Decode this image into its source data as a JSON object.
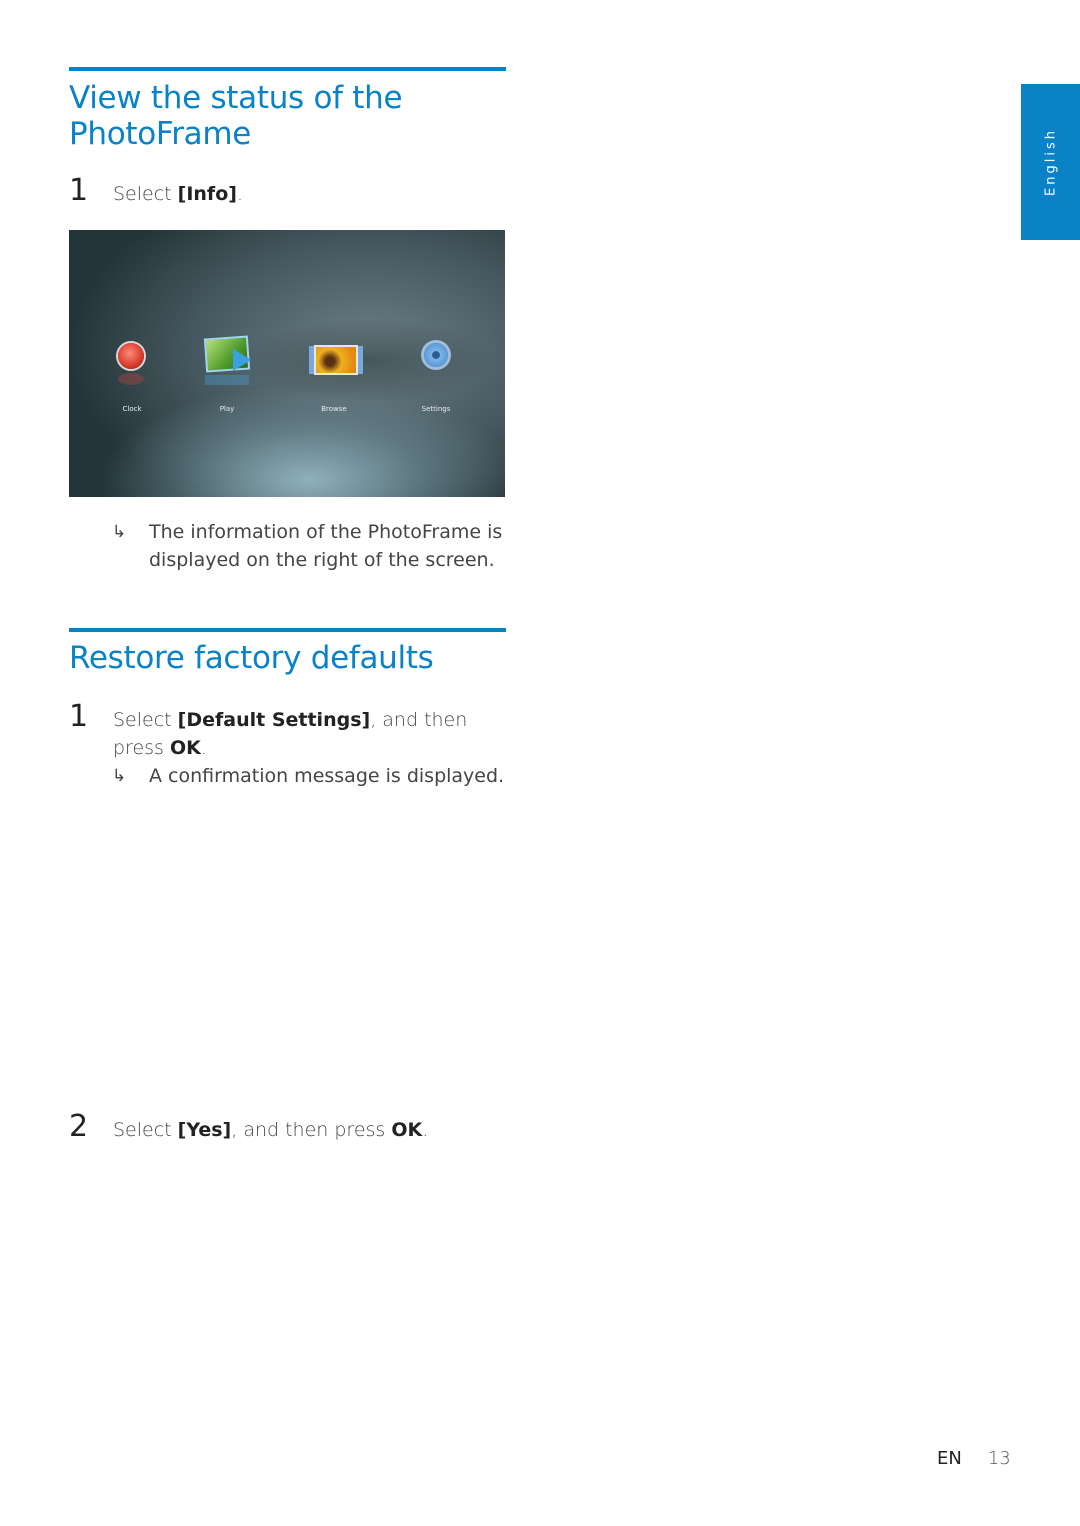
{
  "section1": {
    "title_line1": "View the status of the",
    "title_line2": "PhotoFrame",
    "steps": [
      {
        "number": "1",
        "prefix": "Select ",
        "bold": "[Info]",
        "suffix": "."
      }
    ],
    "screenshot": {
      "apps": [
        {
          "label": "Clock",
          "icon": "clock-icon"
        },
        {
          "label": "Play",
          "icon": "play-slideshow-icon"
        },
        {
          "label": "Browse",
          "icon": "browse-photos-icon"
        },
        {
          "label": "Settings",
          "icon": "settings-gear-icon"
        }
      ]
    },
    "result": {
      "arrow": "↳",
      "text": "The information of the PhotoFrame is displayed on the right of the screen."
    }
  },
  "section2": {
    "title": "Restore factory defaults",
    "steps": [
      {
        "number": "1",
        "prefix": "Select ",
        "bold": "[Default Settings]",
        "middle": ", and then press ",
        "bold2": "OK",
        "suffix": "."
      },
      {
        "number": "2",
        "prefix": "Select ",
        "bold": "[Yes]",
        "middle": ", and then press ",
        "bold2": "OK",
        "suffix": "."
      }
    ],
    "result": {
      "arrow": "↳",
      "text": "A confirmation message is displayed."
    }
  },
  "side_tab": {
    "label": "English"
  },
  "footer": {
    "lang": "EN",
    "page": "13"
  },
  "colors": {
    "accent": "#0a82c8",
    "text": "#444444"
  }
}
